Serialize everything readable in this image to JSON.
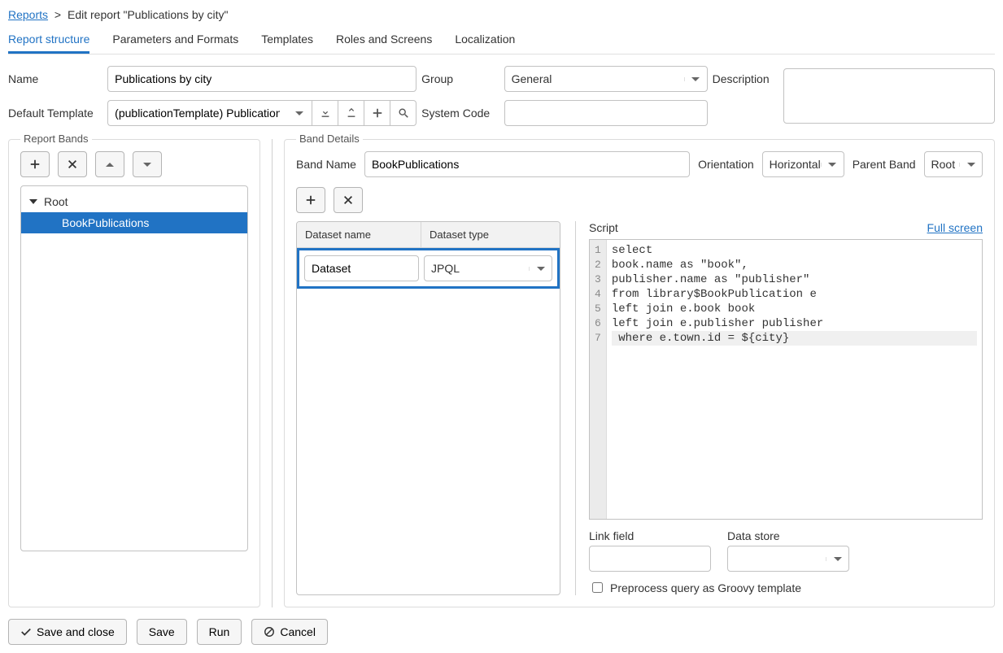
{
  "breadcrumb": {
    "root": "Reports",
    "sep": ">",
    "current": "Edit report \"Publications by city\""
  },
  "tabs": [
    "Report structure",
    "Parameters and Formats",
    "Templates",
    "Roles and Screens",
    "Localization"
  ],
  "form": {
    "labels": {
      "name": "Name",
      "group": "Group",
      "description": "Description",
      "default_template": "Default Template",
      "system_code": "System Code"
    },
    "name": "Publications by city",
    "group": "General",
    "default_template": "(publicationTemplate) Publication",
    "system_code": ""
  },
  "bands": {
    "legend": "Report Bands",
    "root": "Root",
    "selected": "BookPublications"
  },
  "details": {
    "legend": "Band Details",
    "labels": {
      "band_name": "Band Name",
      "orientation": "Orientation",
      "parent_band": "Parent Band"
    },
    "band_name": "BookPublications",
    "orientation": "Horizontal",
    "parent_band": "Root",
    "dataset": {
      "header_name": "Dataset name",
      "header_type": "Dataset type",
      "row_name": "Dataset",
      "row_type": "JPQL"
    },
    "script": {
      "label": "Script",
      "fullscreen": "Full screen",
      "lines": [
        "select",
        "book.name as \"book\",",
        "publisher.name as \"publisher\"",
        "from library$BookPublication e",
        "left join e.book book",
        "left join e.publisher publisher",
        " where e.town.id = ${city}"
      ]
    },
    "footer": {
      "link_field": "Link field",
      "data_store": "Data store",
      "preprocess": "Preprocess query as Groovy template"
    }
  },
  "buttons": {
    "save_close": "Save and close",
    "save": "Save",
    "run": "Run",
    "cancel": "Cancel"
  }
}
